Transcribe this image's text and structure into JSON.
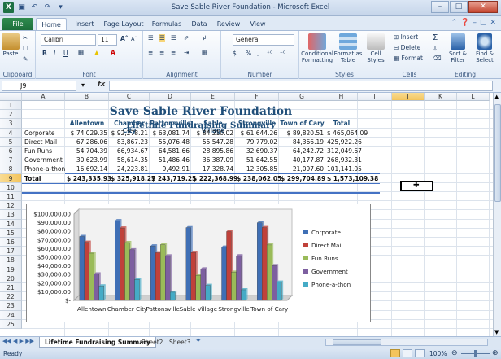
{
  "window": {
    "title": "Save Sable River Foundation - Microsoft Excel",
    "app_icon": "X"
  },
  "ribbon_tabs": [
    "File",
    "Home",
    "Insert",
    "Page Layout",
    "Formulas",
    "Data",
    "Review",
    "View"
  ],
  "ribbon": {
    "clipboard": {
      "paste": "Paste",
      "label": "Clipboard"
    },
    "font": {
      "name": "Calibri",
      "size": "11",
      "bold": "B",
      "italic": "I",
      "underline": "U",
      "label": "Font"
    },
    "alignment": {
      "label": "Alignment"
    },
    "number": {
      "format": "General",
      "currency": "$",
      "percent": "%",
      "comma": ",",
      "label": "Number"
    },
    "styles": {
      "conditional": "Conditional Formatting",
      "format_table": "Format as Table",
      "cell_styles": "Cell Styles",
      "label": "Styles"
    },
    "cells": {
      "insert": "Insert",
      "delete": "Delete",
      "format": "Format",
      "label": "Cells"
    },
    "editing": {
      "sigma": "Σ",
      "sort": "Sort & Filter",
      "find": "Find & Select",
      "label": "Editing"
    }
  },
  "formula_bar": {
    "name_box": "J9",
    "fx": "fx",
    "formula": ""
  },
  "columns": [
    "A",
    "B",
    "C",
    "D",
    "E",
    "F",
    "G",
    "H",
    "I",
    "J",
    "K",
    "L"
  ],
  "selected_column": "J",
  "rows": [
    "1",
    "2",
    "3",
    "4",
    "5",
    "6",
    "7",
    "8",
    "9",
    "10",
    "11",
    "12",
    "13",
    "14",
    "15",
    "16",
    "17",
    "18",
    "19",
    "20",
    "21",
    "22",
    "23",
    "24",
    "25"
  ],
  "selected_row": "9",
  "sheet": {
    "title": "Save Sable River Foundation",
    "subtitle": "Lifetime Fundraising Summary",
    "headers": [
      "Allentown",
      "Chamber City",
      "Pattonsville",
      "Sable Village",
      "Strongville",
      "Town of Cary",
      "Total"
    ],
    "data_rows": [
      {
        "label": "Corporate",
        "values": [
          "$ 74,029.35",
          "$ 92,278.21",
          "$ 63,081.74",
          "$ 84,210.02",
          "$ 61,644.26",
          "$ 89,820.51",
          "$ 465,064.09"
        ]
      },
      {
        "label": "Direct Mail",
        "values": [
          "67,286.06",
          "83,867.23",
          "55,076.48",
          "55,547.28",
          "79,779.02",
          "84,366.19",
          "425,922.26"
        ]
      },
      {
        "label": "Fun Runs",
        "values": [
          "54,704.39",
          "66,934.67",
          "64,581.66",
          "28,895.86",
          "32,690.37",
          "64,242.72",
          "312,049.67"
        ]
      },
      {
        "label": "Government",
        "values": [
          "30,623.99",
          "58,614.35",
          "51,486.46",
          "36,387.09",
          "51,642.55",
          "40,177.87",
          "268,932.31"
        ]
      },
      {
        "label": "Phone-a-thon",
        "values": [
          "16,692.14",
          "24,223.81",
          "9,492.91",
          "17,328.74",
          "12,305.85",
          "21,097.60",
          "101,141.05"
        ]
      }
    ],
    "total_row": {
      "label": "Total",
      "values": [
        "$ 243,335.93",
        "$ 325,918.27",
        "$ 243,719.25",
        "$ 222,368.99",
        "$ 238,062.05",
        "$ 299,704.89",
        "$ 1,573,109.38"
      ]
    }
  },
  "chart_data": {
    "type": "bar",
    "categories": [
      "Allentown",
      "Chamber City",
      "Pattonsville",
      "Sable Village",
      "Strongville",
      "Town of Cary"
    ],
    "series": [
      {
        "name": "Corporate",
        "color": "#3f6fb5",
        "values": [
          74029.35,
          92278.21,
          63081.74,
          84210.02,
          61644.26,
          89820.51
        ]
      },
      {
        "name": "Direct Mail",
        "color": "#c0413a",
        "values": [
          67286.06,
          83867.23,
          55076.48,
          55547.28,
          79779.02,
          84366.19
        ]
      },
      {
        "name": "Fun Runs",
        "color": "#9abb59",
        "values": [
          54704.39,
          66934.67,
          64581.66,
          28895.86,
          32690.37,
          64242.72
        ]
      },
      {
        "name": "Government",
        "color": "#7d5fa0",
        "values": [
          30623.99,
          58614.35,
          51486.46,
          36387.09,
          51642.55,
          40177.87
        ]
      },
      {
        "name": "Phone-a-thon",
        "color": "#45abc6",
        "values": [
          16692.14,
          24223.81,
          9492.91,
          17328.74,
          12305.85,
          21097.6
        ]
      }
    ],
    "yticks": [
      "$-",
      "$10,000.00",
      "$20,000.00",
      "$30,000.00",
      "$40,000.00",
      "$50,000.00",
      "$60,000.00",
      "$70,000.00",
      "$80,000.00",
      "$90,000.00",
      "$100,000.00"
    ],
    "ylim": [
      0,
      100000
    ],
    "legend": "right",
    "grid": false
  },
  "sheet_tabs": [
    "Lifetime Fundraising Summary",
    "Sheet2",
    "Sheet3"
  ],
  "status": {
    "ready": "Ready",
    "zoom": "100%"
  }
}
